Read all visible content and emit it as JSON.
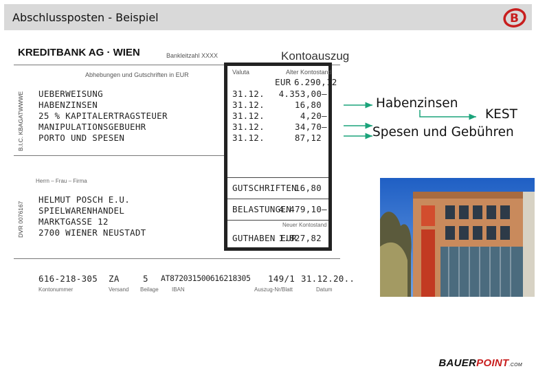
{
  "header": {
    "title": "Abschlussposten - Beispiel",
    "logo_letter": "B",
    "bg_color": "#d9d9d9"
  },
  "statement": {
    "bank_name": "KREDITBANK AG · WIEN",
    "bank_code_label": "Bankleitzahl XXXX",
    "doc_title": "Kontoauszug",
    "bic_side": "B.I.C. KBAGATWWWE",
    "dvr_side": "DVR 0076167",
    "currency_caption": "Abhebungen und Gutschriften in EUR",
    "valuta_label": "Valuta",
    "old_balance_label": "Alter Kontostand",
    "old_balance_currency": "EUR",
    "old_balance_value": "6.290,12",
    "items": [
      {
        "text": "UEBERWEISUNG",
        "date": "31.12.",
        "amount": "4.353,00–"
      },
      {
        "text": "HABENZINSEN",
        "date": "31.12.",
        "amount": "16,80"
      },
      {
        "text": "25 % KAPITALERTRAGSTEUER",
        "date": "31.12.",
        "amount": "4,20–"
      },
      {
        "text": "MANIPULATIONSGEBUEHR",
        "date": "31.12.",
        "amount": "34,70–"
      },
      {
        "text": "PORTO UND SPESEN",
        "date": "31.12.",
        "amount": "87,12"
      }
    ],
    "holder_caption": "Herrn – Frau – Firma",
    "holder": [
      "HELMUT POSCH E.U.",
      "SPIELWARENHANDEL",
      "MARKTGASSE 12",
      "2700 WIENER NEUSTADT"
    ],
    "credits_label": "GUTSCHRIFTEN",
    "credits_value": "16,80",
    "debits_label": "BELASTUNGEN",
    "debits_value": "4.479,10–",
    "new_balance_caption": "Neuer Kontostand",
    "balance_label": "GUTHABEN EUR",
    "balance_value": "1.827,82",
    "footer_values": [
      "616-218-305",
      "ZA",
      "5",
      "AT872031500616218305",
      "149/1",
      "31.12.20.."
    ],
    "footer_labels": [
      "Kontonummer",
      "Versand",
      "Beilage",
      "IBAN",
      "Auszug-Nr/Blatt",
      "Datum"
    ]
  },
  "annotations": {
    "habenzinsen": "Habenzinsen",
    "kest": "KEST",
    "spesen": "Spesen und Gebühren",
    "arrow_color": "#1aa37a"
  },
  "brand": {
    "part1": "BAUER",
    "part2": "POINT",
    "suffix": ".COM",
    "accent": "#c81e1e"
  }
}
